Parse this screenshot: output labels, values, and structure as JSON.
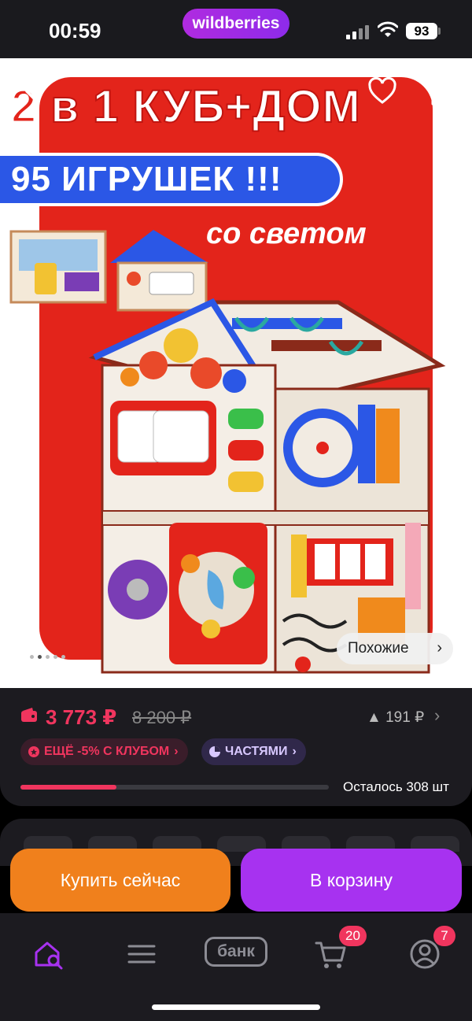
{
  "status_bar": {
    "time": "00:59",
    "app_badge": "wildberries",
    "battery": "93"
  },
  "product_image": {
    "promo_line1_prefix": "2",
    "promo_line1_rest": " в 1 КУБ+ДОМ",
    "promo_line2": "95 ИГРУШЕК !!!",
    "promo_line3": "со светом",
    "similar_label": "Похожие",
    "gallery_dots": 5,
    "gallery_active_index": 1
  },
  "price": {
    "current": "3 773 ₽",
    "old": "8 200 ₽",
    "trend": "▲ 191 ₽",
    "club_badge": "ЕЩЁ -5% С КЛУБОМ",
    "installments_badge": "ЧАСТЯМИ",
    "stock_text": "Осталось 308 шт",
    "stock_progress": 0.31
  },
  "actions": {
    "buy_now": "Купить сейчас",
    "add_to_cart": "В корзину"
  },
  "tab_bar": {
    "bank_label": "банк",
    "cart_count": "20",
    "profile_count": "7"
  },
  "colors": {
    "accent_pink": "#f0355e",
    "buy_orange": "#f0801c",
    "cart_purple": "#a732f0",
    "promo_red": "#e3241b",
    "promo_blue": "#2b57e6"
  }
}
